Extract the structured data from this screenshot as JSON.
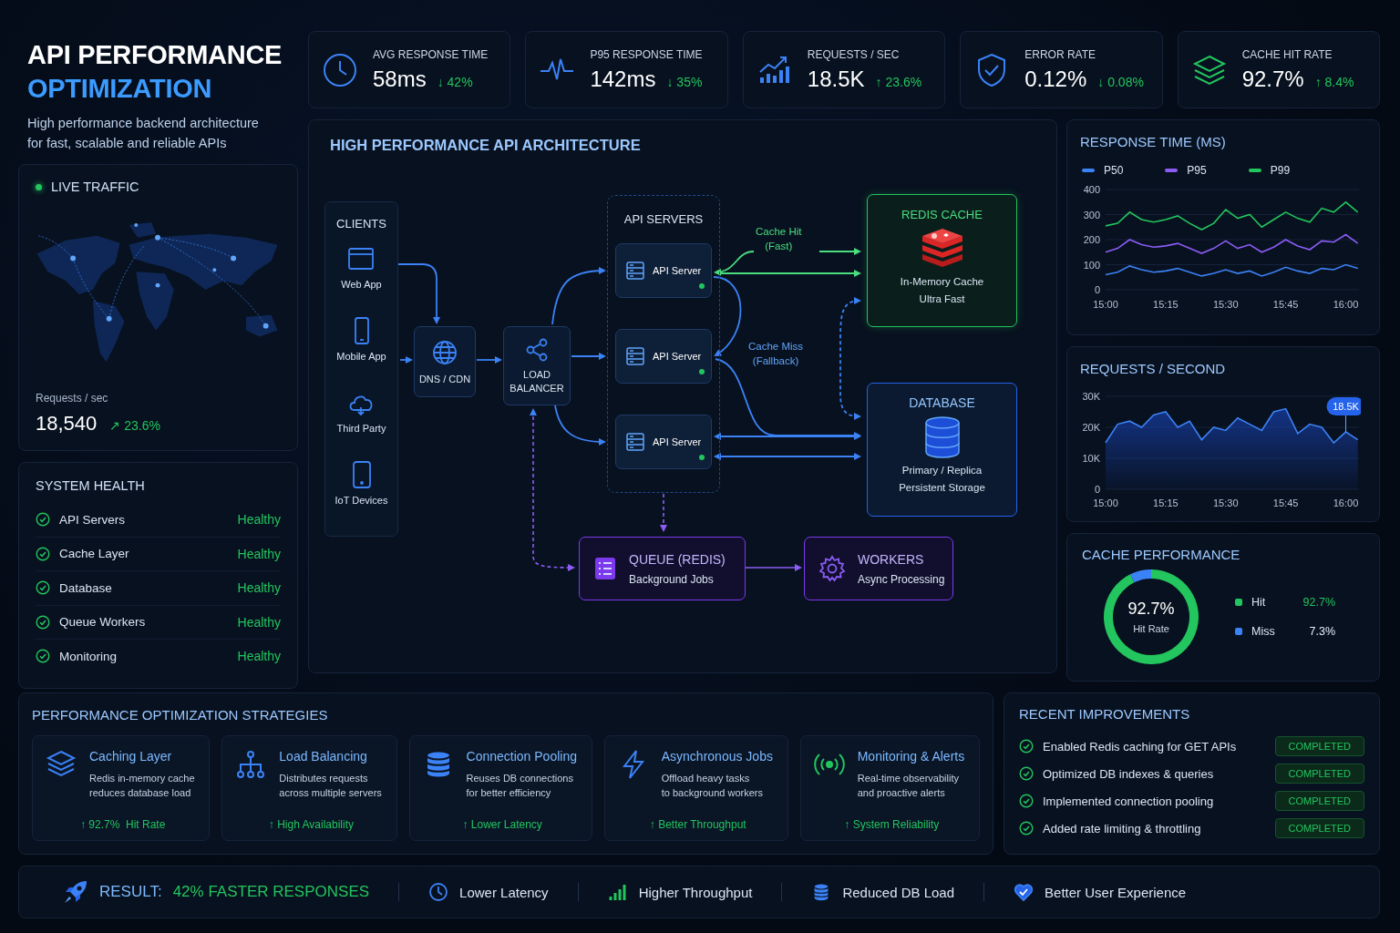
{
  "header": {
    "title_lines": [
      "API PERFORMANCE",
      "OPTIMIZATION"
    ],
    "subtitle_lines": [
      "High performance backend architecture",
      "for fast, scalable and reliable APIs"
    ]
  },
  "metrics": [
    {
      "label": "AVG RESPONSE TIME",
      "value": "58ms",
      "delta": "↓ 42%"
    },
    {
      "label": "P95 RESPONSE TIME",
      "value": "142ms",
      "delta": "↓ 35%"
    },
    {
      "label": "REQUESTS / SEC",
      "value": "18.5K",
      "delta": "↑ 23.6%"
    },
    {
      "label": "ERROR RATE",
      "value": "0.12%",
      "delta": "↓ 0.08%"
    },
    {
      "label": "CACHE HIT RATE",
      "value": "92.7%",
      "delta": "↑ 8.4%"
    }
  ],
  "live_traffic": {
    "title": "LIVE TRAFFIC",
    "metric_label": "Requests / sec",
    "value": "18,540",
    "delta": "↗ 23.6%"
  },
  "system_health": {
    "title": "SYSTEM HEALTH",
    "items": [
      {
        "name": "API Servers",
        "status": "Healthy"
      },
      {
        "name": "Cache Layer",
        "status": "Healthy"
      },
      {
        "name": "Database",
        "status": "Healthy"
      },
      {
        "name": "Queue Workers",
        "status": "Healthy"
      },
      {
        "name": "Monitoring",
        "status": "Healthy"
      }
    ]
  },
  "architecture": {
    "title": "HIGH PERFORMANCE API ARCHITECTURE",
    "clients": {
      "title": "CLIENTS",
      "items": [
        "Web App",
        "Mobile App",
        "Third Party",
        "IoT Devices"
      ]
    },
    "dns": "DNS / CDN",
    "load_balancer": "LOAD BALANCER",
    "api_servers": {
      "title": "API SERVERS",
      "servers": [
        {
          "label": "API Server",
          "online": true
        },
        {
          "label": "API Server",
          "online": true
        },
        {
          "label": "API Server",
          "online": true
        }
      ]
    },
    "redis": {
      "title": "REDIS CACHE",
      "lines": [
        "In-Memory Cache",
        "Ultra Fast"
      ]
    },
    "database": {
      "title": "DATABASE",
      "lines": [
        "Primary / Replica",
        "Persistent Storage"
      ]
    },
    "queue": {
      "title": "QUEUE (REDIS)",
      "subtitle": "Background Jobs"
    },
    "workers": {
      "title": "WORKERS",
      "subtitle": "Async Processing"
    },
    "edge_labels": [
      {
        "lines": [
          "Cache Hit",
          "(Fast)"
        ]
      },
      {
        "lines": [
          "Cache Miss",
          "(Fallback)"
        ]
      }
    ]
  },
  "response_time": {
    "title": "RESPONSE TIME (MS)",
    "chart_data": {
      "type": "line",
      "categories": [
        "15:00",
        null,
        null,
        null,
        null,
        "15:15",
        null,
        null,
        null,
        null,
        "15:30",
        null,
        null,
        null,
        null,
        "15:45",
        null,
        null,
        null,
        null,
        "16:00",
        null
      ],
      "ylim": [
        0,
        400
      ],
      "yticks": [
        0,
        100,
        200,
        300,
        400
      ],
      "grid": true,
      "series": [
        {
          "name": "P50",
          "color": "#3b82f6",
          "values": [
            60,
            70,
            95,
            80,
            70,
            75,
            85,
            70,
            55,
            65,
            80,
            65,
            75,
            55,
            70,
            90,
            75,
            65,
            85,
            80,
            100,
            85
          ]
        },
        {
          "name": "P95",
          "color": "#8b5cf6",
          "values": [
            150,
            165,
            200,
            180,
            170,
            175,
            185,
            165,
            145,
            165,
            195,
            165,
            180,
            150,
            170,
            200,
            175,
            160,
            195,
            190,
            220,
            185
          ]
        },
        {
          "name": "P99",
          "color": "#22c55e",
          "values": [
            255,
            265,
            310,
            280,
            270,
            280,
            295,
            265,
            240,
            265,
            320,
            285,
            300,
            250,
            280,
            310,
            285,
            270,
            325,
            310,
            350,
            310
          ]
        }
      ]
    }
  },
  "requests": {
    "title": "REQUESTS / SECOND",
    "chart_data": {
      "type": "area",
      "categories": [
        "15:00",
        null,
        null,
        null,
        null,
        "15:15",
        null,
        null,
        null,
        null,
        "15:30",
        null,
        null,
        null,
        null,
        "15:45",
        null,
        null,
        null,
        null,
        "16:00",
        null
      ],
      "ylim": [
        0,
        30000
      ],
      "yticks": [
        {
          "value": 0,
          "label": "0"
        },
        {
          "value": 10000,
          "label": "10K"
        },
        {
          "value": 20000,
          "label": "20K"
        },
        {
          "value": 30000,
          "label": "30K"
        }
      ],
      "values": [
        15000,
        21000,
        22000,
        20000,
        24000,
        25000,
        20000,
        22000,
        16000,
        20000,
        19000,
        23000,
        21000,
        19000,
        25000,
        26000,
        18000,
        21000,
        20000,
        15000,
        18500,
        16000
      ],
      "grid": true,
      "annotations": [
        {
          "x": "16:00",
          "y": 18500,
          "text": "18.5K"
        }
      ]
    }
  },
  "cache": {
    "title": "CACHE PERFORMANCE",
    "center_value": "92.7%",
    "center_label": "Hit Rate",
    "chart_data": {
      "type": "donut",
      "categories": [
        "Hit",
        "Miss"
      ],
      "values": [
        92.7,
        7.3
      ]
    },
    "legend": [
      {
        "value": "92.7%",
        "color": "#22c55e"
      },
      {
        "value": "7.3%",
        "color": "#3b82f6"
      }
    ]
  },
  "strategies": {
    "title": "PERFORMANCE OPTIMIZATION STRATEGIES",
    "items": [
      {
        "title": "Caching Layer",
        "lines": [
          "Redis in-memory cache",
          "reduces database load"
        ],
        "outcome": "↑ 92.7%  Hit Rate"
      },
      {
        "title": "Load Balancing",
        "lines": [
          "Distributes requests",
          "across multiple servers"
        ],
        "outcome": "↑ High Availability"
      },
      {
        "title": "Connection Pooling",
        "lines": [
          "Reuses DB connections",
          "for better efficiency"
        ],
        "outcome": "↑ Lower Latency"
      },
      {
        "title": "Asynchronous Jobs",
        "lines": [
          "Offload heavy tasks",
          "to background workers"
        ],
        "outcome": "↑ Better Throughput"
      },
      {
        "title": "Monitoring & Alerts",
        "lines": [
          "Real-time observability",
          "and proactive alerts"
        ],
        "outcome": "↑ System Reliability"
      }
    ]
  },
  "recent_improvements": {
    "title": "RECENT IMPROVEMENTS",
    "items": [
      {
        "text": "Enabled Redis caching for GET APIs",
        "status": "COMPLETED"
      },
      {
        "text": "Optimized DB indexes & queries",
        "status": "COMPLETED"
      },
      {
        "text": "Implemented connection pooling",
        "status": "COMPLETED"
      },
      {
        "text": "Added rate limiting & throttling",
        "status": "COMPLETED"
      }
    ]
  },
  "result": {
    "label": "RESULT:",
    "headline": "42% FASTER RESPONSES",
    "items": [
      "Lower Latency",
      "Higher Throughput",
      "Reduced DB Load",
      "Better User Experience"
    ]
  }
}
